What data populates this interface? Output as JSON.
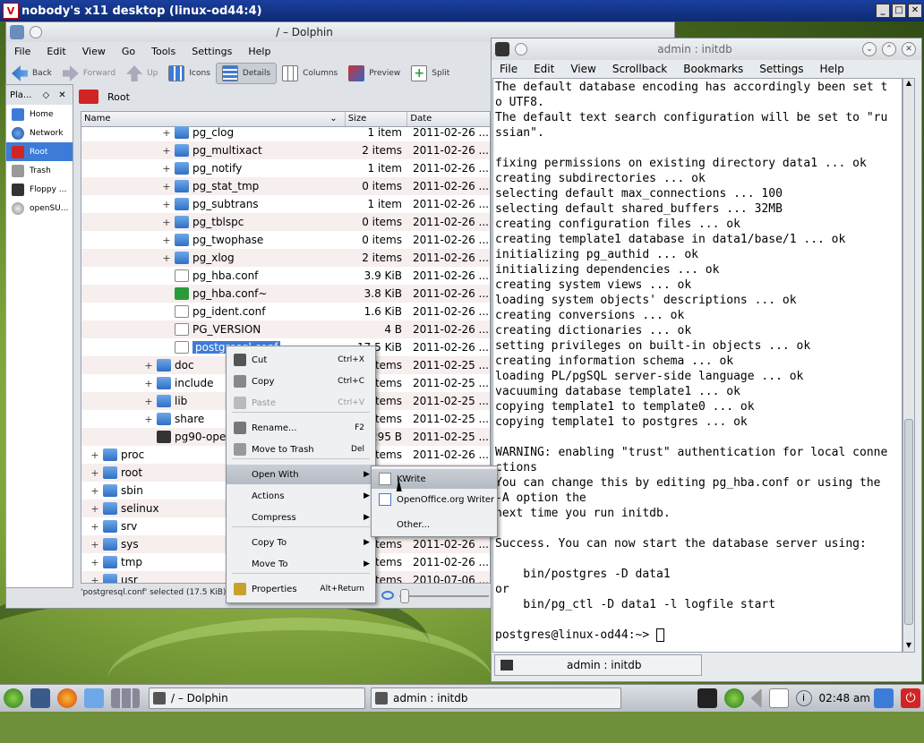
{
  "vnc": {
    "title": "nobody's x11 desktop (linux-od44:4)",
    "logo": "V"
  },
  "dolphin": {
    "title": "/ – Dolphin",
    "menu": [
      "File",
      "Edit",
      "View",
      "Go",
      "Tools",
      "Settings",
      "Help"
    ],
    "toolbar": {
      "back": "Back",
      "forward": "Forward",
      "up": "Up",
      "icons": "Icons",
      "details": "Details",
      "columns": "Columns",
      "preview": "Preview",
      "split": "Split"
    },
    "places": {
      "title": "Pla...",
      "items": [
        {
          "label": "Home",
          "icon": "home-icon"
        },
        {
          "label": "Network",
          "icon": "network-icon"
        },
        {
          "label": "Root",
          "icon": "root-icon"
        },
        {
          "label": "Trash",
          "icon": "trash-icon"
        },
        {
          "label": "Floppy ...",
          "icon": "floppy-icon"
        },
        {
          "label": "openSU...",
          "icon": "dvd-icon"
        }
      ]
    },
    "breadcrumb": "Root",
    "columns": {
      "name": "Name",
      "size": "Size",
      "date": "Date"
    },
    "rows": [
      {
        "name": "pg_clog",
        "size": "1 item",
        "date": "2011-02-26 ...",
        "level": 3,
        "type": "folder",
        "exp": true
      },
      {
        "name": "pg_multixact",
        "size": "2 items",
        "date": "2011-02-26 ...",
        "level": 3,
        "type": "folder",
        "exp": true
      },
      {
        "name": "pg_notify",
        "size": "1 item",
        "date": "2011-02-26 ...",
        "level": 3,
        "type": "folder",
        "exp": true
      },
      {
        "name": "pg_stat_tmp",
        "size": "0 items",
        "date": "2011-02-26 ...",
        "level": 3,
        "type": "folder",
        "exp": true
      },
      {
        "name": "pg_subtrans",
        "size": "1 item",
        "date": "2011-02-26 ...",
        "level": 3,
        "type": "folder",
        "exp": true
      },
      {
        "name": "pg_tblspc",
        "size": "0 items",
        "date": "2011-02-26 ...",
        "level": 3,
        "type": "folder",
        "exp": true
      },
      {
        "name": "pg_twophase",
        "size": "0 items",
        "date": "2011-02-26 ...",
        "level": 3,
        "type": "folder",
        "exp": true
      },
      {
        "name": "pg_xlog",
        "size": "2 items",
        "date": "2011-02-26 ...",
        "level": 3,
        "type": "folder",
        "exp": true
      },
      {
        "name": "pg_hba.conf",
        "size": "3.9 KiB",
        "date": "2011-02-26 ...",
        "level": 3,
        "type": "doc",
        "exp": false
      },
      {
        "name": "pg_hba.conf~",
        "size": "3.8 KiB",
        "date": "2011-02-26 ...",
        "level": 3,
        "type": "green",
        "exp": false
      },
      {
        "name": "pg_ident.conf",
        "size": "1.6 KiB",
        "date": "2011-02-26 ...",
        "level": 3,
        "type": "doc",
        "exp": false
      },
      {
        "name": "PG_VERSION",
        "size": "4 B",
        "date": "2011-02-26 ...",
        "level": 3,
        "type": "doc",
        "exp": false
      },
      {
        "name": "postgresql.conf",
        "size": "17.5 KiB",
        "date": "2011-02-26 ...",
        "level": 3,
        "type": "doc",
        "exp": false,
        "selected": true
      },
      {
        "name": "doc",
        "size": "items",
        "date": "2011-02-25 ...",
        "level": 2,
        "type": "folder",
        "exp": true
      },
      {
        "name": "include",
        "size": "items",
        "date": "2011-02-25 ...",
        "level": 2,
        "type": "folder",
        "exp": true
      },
      {
        "name": "lib",
        "size": "items",
        "date": "2011-02-25 ...",
        "level": 2,
        "type": "folder",
        "exp": true
      },
      {
        "name": "share",
        "size": "items",
        "date": "2011-02-25 ...",
        "level": 2,
        "type": "folder",
        "exp": true
      },
      {
        "name": "pg90-oper",
        "size": "295 B",
        "date": "2011-02-25 ...",
        "level": 2,
        "type": "exe",
        "exp": false
      },
      {
        "name": "proc",
        "size": "items",
        "date": "2011-02-26 ...",
        "level": 0,
        "type": "folder",
        "exp": true
      },
      {
        "name": "root",
        "size": "items",
        "date": "2011-02-26 ...",
        "level": 0,
        "type": "folder",
        "exp": true
      },
      {
        "name": "sbin",
        "size": "items",
        "date": "2011-02-26 ...",
        "level": 0,
        "type": "folder",
        "exp": true
      },
      {
        "name": "selinux",
        "size": "items",
        "date": "2011-02-26 ...",
        "level": 0,
        "type": "folder",
        "exp": true
      },
      {
        "name": "srv",
        "size": "items",
        "date": "2011-02-26 ...",
        "level": 0,
        "type": "folder",
        "exp": true
      },
      {
        "name": "sys",
        "size": "items",
        "date": "2011-02-26 ...",
        "level": 0,
        "type": "folder",
        "exp": true
      },
      {
        "name": "tmp",
        "size": "items",
        "date": "2011-02-26 ...",
        "level": 0,
        "type": "folder",
        "exp": true
      },
      {
        "name": "usr",
        "size": "items",
        "date": "2010-07-06 ...",
        "level": 0,
        "type": "folder",
        "exp": true
      }
    ],
    "status": "'postgresql.conf' selected (17.5 KiB)"
  },
  "context_menu": {
    "items": [
      {
        "label": "Cut",
        "shortcut": "Ctrl+X",
        "icon": "scissors-icon"
      },
      {
        "label": "Copy",
        "shortcut": "Ctrl+C",
        "icon": "copy-icon"
      },
      {
        "label": "Paste",
        "shortcut": "Ctrl+V",
        "icon": "paste-icon",
        "disabled": true
      },
      {
        "label": "Rename...",
        "shortcut": "F2",
        "icon": "rename-icon"
      },
      {
        "label": "Move to Trash",
        "shortcut": "Del",
        "icon": "trash-icon"
      },
      {
        "label": "Open With",
        "submenu": true,
        "highlighted": true
      },
      {
        "label": "Actions",
        "submenu": true
      },
      {
        "label": "Compress",
        "submenu": true
      },
      {
        "label": "Copy To",
        "submenu": true
      },
      {
        "label": "Move To",
        "submenu": true
      },
      {
        "label": "Properties",
        "shortcut": "Alt+Return",
        "icon": "properties-icon"
      }
    ]
  },
  "submenu": {
    "items": [
      {
        "label": "KWrite"
      },
      {
        "label": "OpenOffice.org Writer"
      },
      {
        "label": "Other..."
      }
    ]
  },
  "terminal": {
    "title": "admin : initdb",
    "menu": [
      "File",
      "Edit",
      "View",
      "Scrollback",
      "Bookmarks",
      "Settings",
      "Help"
    ],
    "lines": [
      "The default database encoding has accordingly been set t",
      "o UTF8.",
      "The default text search configuration will be set to \"ru",
      "ssian\".",
      "",
      "fixing permissions on existing directory data1 ... ok",
      "creating subdirectories ... ok",
      "selecting default max_connections ... 100",
      "selecting default shared_buffers ... 32MB",
      "creating configuration files ... ok",
      "creating template1 database in data1/base/1 ... ok",
      "initializing pg_authid ... ok",
      "initializing dependencies ... ok",
      "creating system views ... ok",
      "loading system objects' descriptions ... ok",
      "creating conversions ... ok",
      "creating dictionaries ... ok",
      "setting privileges on built-in objects ... ok",
      "creating information schema ... ok",
      "loading PL/pgSQL server-side language ... ok",
      "vacuuming database template1 ... ok",
      "copying template1 to template0 ... ok",
      "copying template1 to postgres ... ok",
      "",
      "WARNING: enabling \"trust\" authentication for local conne",
      "ctions",
      "You can change this by editing pg_hba.conf or using the",
      "-A option the",
      "next time you run initdb.",
      "",
      "Success. You can now start the database server using:",
      "",
      "    bin/postgres -D data1",
      "or",
      "    bin/pg_ctl -D data1 -l logfile start",
      "",
      "postgres@linux-od44:~> "
    ],
    "tab": "admin : initdb"
  },
  "taskbar": {
    "tasks": [
      "/ – Dolphin",
      "admin : initdb"
    ],
    "clock": "02:48 am"
  }
}
